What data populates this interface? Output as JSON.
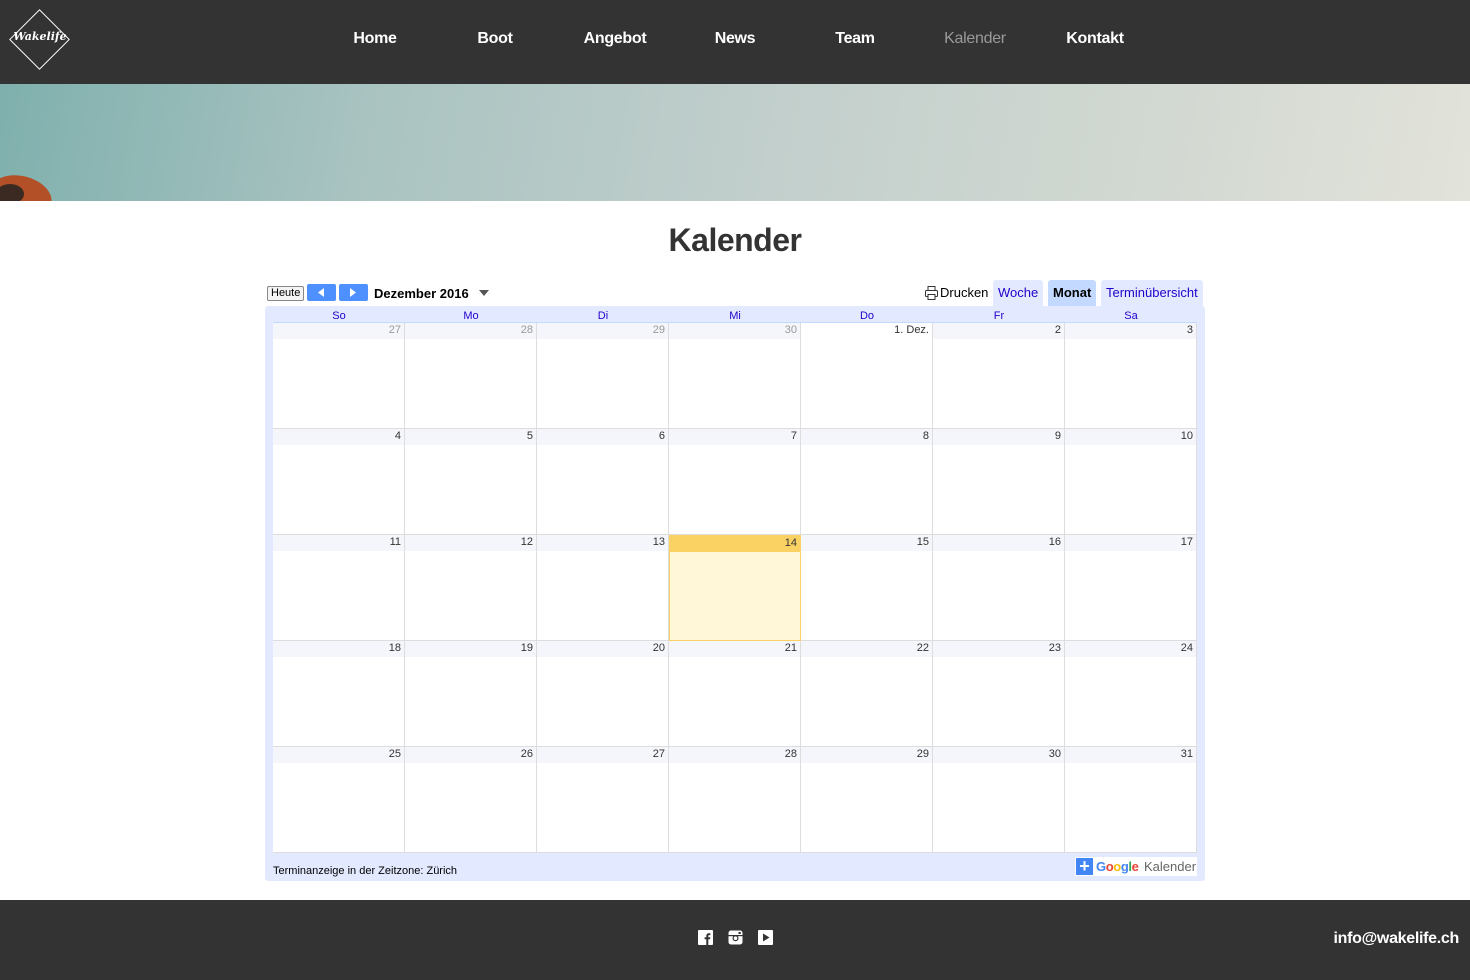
{
  "header": {
    "logo_text": "Wakelife",
    "nav": [
      "Home",
      "Boot",
      "Angebot",
      "News",
      "Team",
      "Kalender",
      "Kontakt"
    ],
    "active": "Kalender"
  },
  "page": {
    "title": "Kalender"
  },
  "calendar": {
    "today_label": "Heute",
    "month_label": "Dezember 2016",
    "print_label": "Drucken",
    "views": [
      "Woche",
      "Monat",
      "Terminübersicht"
    ],
    "selected_view": "Monat",
    "weekdays": [
      "So",
      "Mo",
      "Di",
      "Mi",
      "Do",
      "Fr",
      "Sa"
    ],
    "weeks": [
      [
        "27",
        "28",
        "29",
        "30",
        "1. Dez.",
        "2",
        "3"
      ],
      [
        "4",
        "5",
        "6",
        "7",
        "8",
        "9",
        "10"
      ],
      [
        "11",
        "12",
        "13",
        "14",
        "15",
        "16",
        "17"
      ],
      [
        "18",
        "19",
        "20",
        "21",
        "22",
        "23",
        "24"
      ],
      [
        "25",
        "26",
        "27",
        "28",
        "29",
        "30",
        "31"
      ]
    ],
    "other_month_days": 4,
    "today": "14",
    "timezone_text": "Terminanzeige in der Zeitzone: Zürich",
    "badge_brand": "Google",
    "badge_product": "Kalender",
    "colors": {
      "today_header": "#fad163",
      "today_bg": "#fff7d7",
      "frame": "#e3e9ff",
      "link": "#2200cc"
    }
  },
  "footer": {
    "social": [
      "facebook-icon",
      "instagram-icon",
      "youtube-icon"
    ],
    "email": "info@wakelife.ch"
  }
}
